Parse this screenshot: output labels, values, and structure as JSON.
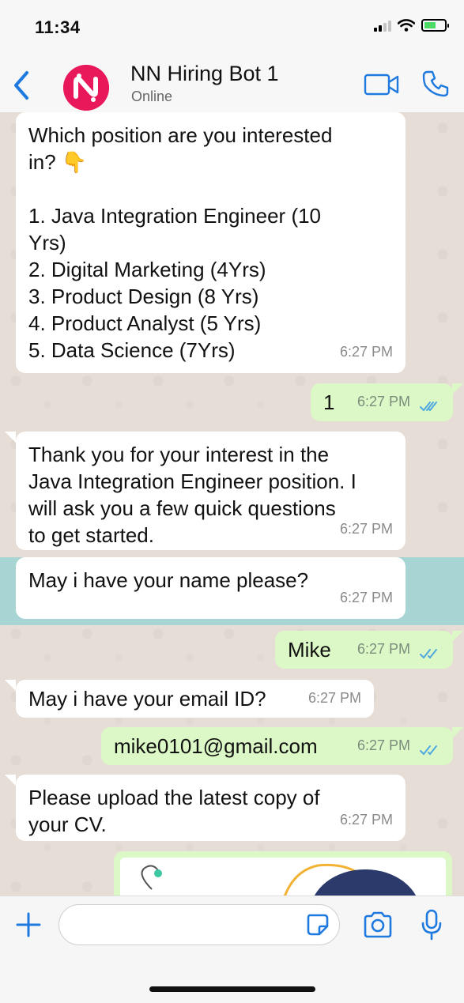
{
  "status_bar": {
    "time": "11:34"
  },
  "header": {
    "contact_name": "NN Hiring Bot 1",
    "contact_status": "Online"
  },
  "colors": {
    "ios_blue": "#1f7ae0",
    "avatar_pink": "#e8185a",
    "outgoing_bubble": "#dcf8c6",
    "incoming_bubble": "#ffffff",
    "read_ticks": "#4fa8e0"
  },
  "icons": [
    "chevron-left-icon",
    "video-camera-icon",
    "phone-icon",
    "plus-icon",
    "sticker-icon",
    "camera-icon",
    "microphone-icon"
  ],
  "messages": [
    {
      "direction": "in",
      "text": "Which position are you interested\nin? 👇\n\n1. Java Integration Engineer (10\nYrs)\n2. Digital Marketing (4Yrs)\n3. Product Design (8 Yrs)\n4. Product Analyst (5 Yrs)\n5. Data Science (7Yrs)",
      "time": "6:27 PM"
    },
    {
      "direction": "out",
      "text": "1",
      "time": "6:27 PM",
      "read": true
    },
    {
      "direction": "in",
      "text": "Thank you for your interest in the\nJava Integration Engineer position. I\nwill ask you a few quick questions\nto get started.",
      "time": "6:27 PM"
    },
    {
      "direction": "in",
      "text": "May i have your name please?",
      "time": "6:27 PM"
    },
    {
      "direction": "out",
      "text": "Mike",
      "time": "6:27 PM",
      "read": true
    },
    {
      "direction": "in",
      "text": "May i have your email ID?",
      "time": "6:27 PM"
    },
    {
      "direction": "out",
      "text": "mike0101@gmail.com",
      "time": "6:27 PM",
      "read": true
    },
    {
      "direction": "in",
      "text": "Please upload the latest copy of\nyour CV.",
      "time": "6:27 PM"
    }
  ],
  "input": {
    "placeholder": ""
  }
}
